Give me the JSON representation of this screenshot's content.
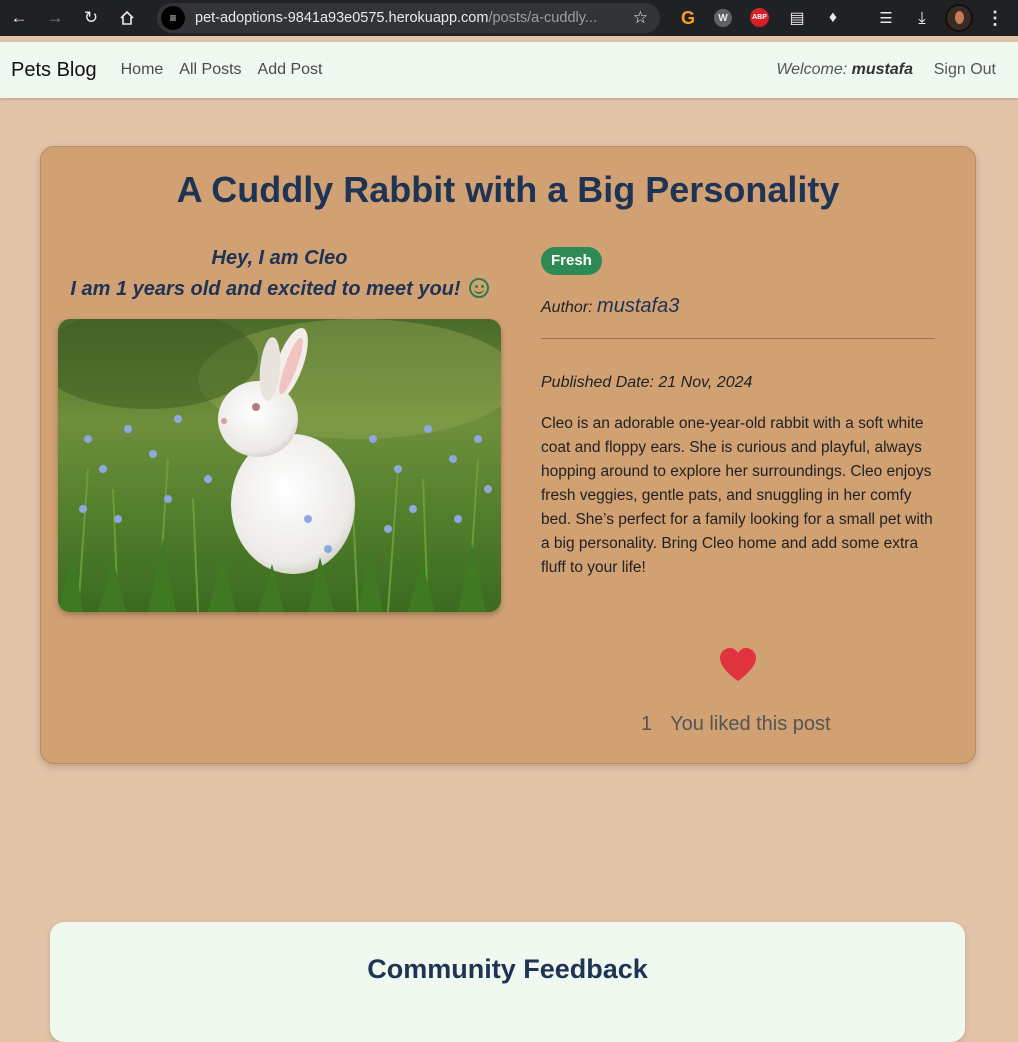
{
  "browser": {
    "url_host": "pet-adoptions-9841a93e0575.herokuapp.com",
    "url_path": "/posts/a-cuddly..."
  },
  "navbar": {
    "brand": "Pets Blog",
    "links": [
      "Home",
      "All Posts",
      "Add Post"
    ],
    "welcome_prefix": "Welcome:",
    "username": "mustafa",
    "sign_out": "Sign Out"
  },
  "post": {
    "title": "A Cuddly Rabbit with a Big Personality",
    "greeting_line1": "Hey, I am Cleo",
    "greeting_line2": "I am 1 years old and excited to meet you!",
    "badge": "Fresh",
    "author_label": "Author:",
    "author_name": "mustafa3",
    "published": "Published Date: 21 Nov, 2024",
    "description": "Cleo is an adorable one-year-old rabbit with a soft white coat and floppy ears. She is curious and playful, always hopping around to explore her surroundings. Cleo enjoys fresh veggies, gentle pats, and snuggling in her comfy bed. She’s perfect for a family looking for a small pet with a big personality. Bring Cleo home and add some extra fluff to your life!",
    "like_count": "1",
    "like_text": "You liked this post"
  },
  "feedback": {
    "title": "Community Feedback"
  },
  "colors": {
    "page_bg": "#e3c4a8",
    "card_bg": "#d1a073",
    "title": "#1f3354",
    "badge": "#2d8a55",
    "heart": "#e0323f",
    "navbar_bg": "#eff9ef"
  }
}
